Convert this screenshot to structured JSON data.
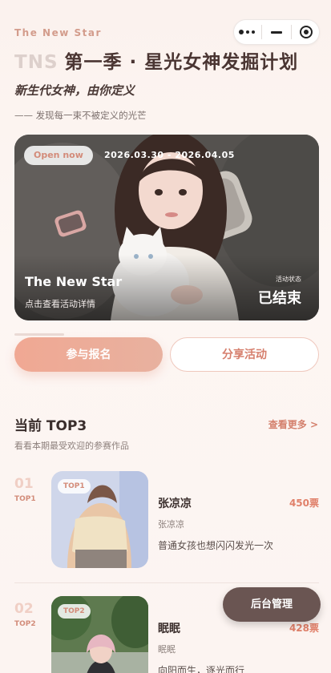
{
  "header": {
    "brand": "The New Star",
    "title_prefix": "TNS",
    "title_main": "第一季 · 星光女神发掘计划",
    "subtitle": "新生代女神，由你定义",
    "tagline": "—— 发现每一束不被定义的光芒"
  },
  "capsule": {
    "icons": [
      "more-icon",
      "minimize-icon",
      "close-target-icon"
    ]
  },
  "banner": {
    "badge": "Open now",
    "date_range": "2026.03.30 - 2026.04.05",
    "title": "The New Star",
    "hint": "点击查看活动详情",
    "status_label": "活动状态",
    "status_value": "已结束"
  },
  "actions": {
    "join": "参与报名",
    "share": "分享活动"
  },
  "top3": {
    "title": "当前 TOP3",
    "subtitle": "看看本期最受欢迎的参赛作品",
    "see_more": "查看更多 >",
    "items": [
      {
        "num": "01",
        "tag": "TOP1",
        "badge": "TOP1",
        "name": "张凉凉",
        "votes": "450票",
        "user": "张凉凉",
        "desc": "普通女孩也想闪闪发光一次"
      },
      {
        "num": "02",
        "tag": "TOP2",
        "badge": "TOP2",
        "name": "眠眠",
        "votes": "428票",
        "user": "眠眠",
        "desc": "向阳而生，逐光而行"
      }
    ]
  },
  "admin_button": "后台管理",
  "colors": {
    "accent": "#e8a28e",
    "accent_text": "#d4806d",
    "dark": "#6a5552"
  }
}
